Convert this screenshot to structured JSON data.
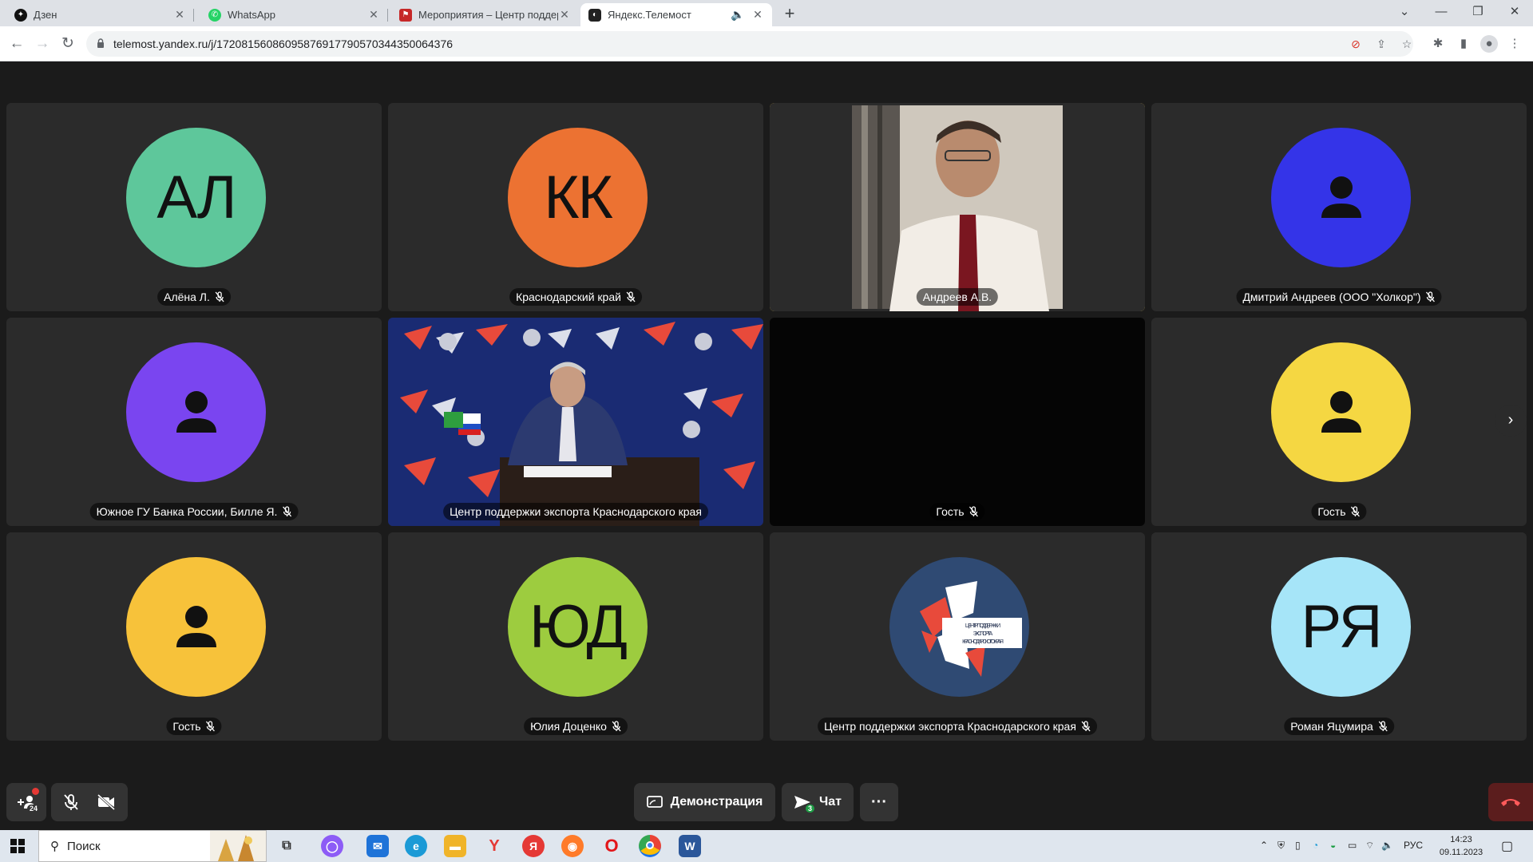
{
  "browser": {
    "tabs": [
      {
        "title": "Дзен",
        "favicon": "dzen-icon",
        "favicon_color": "#111111",
        "active": false
      },
      {
        "title": "WhatsApp",
        "favicon": "whatsapp-icon",
        "favicon_color": "#25d366",
        "active": false
      },
      {
        "title": "Мероприятия – Центр поддерж",
        "favicon": "flag-icon",
        "favicon_color": "#c62828",
        "active": false
      },
      {
        "title": "Яндекс.Телемост",
        "favicon": "telemost-icon",
        "favicon_color": "#222222",
        "active": true
      }
    ],
    "new_tab_label": "+",
    "url": "telemost.yandex.ru/j/17208156086095876917790570344350064376"
  },
  "participants": [
    {
      "name": "Алёна Л.",
      "initials": "АЛ",
      "color": "#5ec79b",
      "kind": "initials",
      "muted": true
    },
    {
      "name": "Краснодарский край",
      "initials": "КК",
      "color": "#ec7232",
      "kind": "initials",
      "muted": true
    },
    {
      "name": "Андреев А.В.",
      "initials": "",
      "color": "#d9d3c9",
      "kind": "video-speaker",
      "muted": false,
      "speaking": true
    },
    {
      "name": "Дмитрий Андреев (ООО \"Холкор\")",
      "initials": "",
      "color": "#3434e8",
      "kind": "person-icon",
      "muted": true
    },
    {
      "name": "Южное ГУ Банка России, Билле Я.",
      "initials": "",
      "color": "#7a45f0",
      "kind": "person-icon",
      "muted": true
    },
    {
      "name": "Центр поддержки экспорта Краснодарского края",
      "initials": "",
      "color": "#1c2a6b",
      "kind": "video-studio",
      "muted": false
    },
    {
      "name": "Гость",
      "initials": "",
      "color": "#050505",
      "kind": "black",
      "muted": true
    },
    {
      "name": "Гость",
      "initials": "",
      "color": "#f5d742",
      "kind": "person-icon",
      "muted": true
    },
    {
      "name": "Гость",
      "initials": "",
      "color": "#f7c23a",
      "kind": "person-icon",
      "muted": true
    },
    {
      "name": "Юлия Доценко",
      "initials": "ЮД",
      "color": "#9dcc3f",
      "kind": "initials",
      "muted": true
    },
    {
      "name": "Центр поддержки экспорта Краснодарского края",
      "initials": "",
      "color": "#2f4a73",
      "kind": "logo",
      "muted": true,
      "logo_text": "ЦЕНТР ПОДДЕРЖКИ ЭКСПОРТА КРАСНОДАРСКОГО КРАЯ"
    },
    {
      "name": "Роман Яцумира",
      "initials": "РЯ",
      "color": "#a6e5f8",
      "kind": "initials",
      "muted": true
    }
  ],
  "controls": {
    "participants_count": "24",
    "demo_label": "Демонстрация",
    "chat_label": "Чат",
    "chat_badge": "3",
    "more_label": "···"
  },
  "taskbar": {
    "search_placeholder": "Поиск",
    "lang": "РУС",
    "time": "14:23",
    "date": "09.11.2023"
  }
}
